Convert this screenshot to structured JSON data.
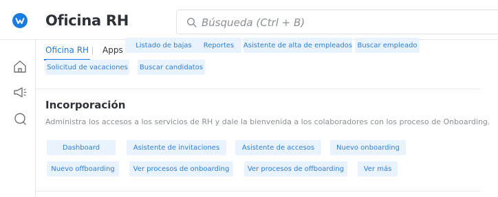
{
  "header": {
    "app_title": "Oficina RH",
    "search_placeholder": "Búsqueda (Ctrl + B)"
  },
  "tabs": [
    {
      "label": "Oficina RH",
      "active": true
    },
    {
      "label": "Apps",
      "active": false
    }
  ],
  "top_links_row1": [
    "Listado de bajas",
    "Reportes",
    "Asistente de alta de empleados",
    "Buscar empleado"
  ],
  "top_links_row2": [
    "Solicitud de vacaciones",
    "Buscar candidatos"
  ],
  "section": {
    "title": "Incorporación",
    "description": "Administra los accesos a los servicios de RH y dale la bienvenida a los colaboradores con los proceso de Onboarding.",
    "actions_row1": [
      "Dashboard",
      "Asistente de invitaciones",
      "Asistente de accesos",
      "Nuevo onboarding"
    ],
    "actions_row2": [
      "Nuevo offboarding",
      "Ver procesos de onboarding",
      "Ver procesos de offboarding",
      "Ver más"
    ]
  },
  "rail_icons": [
    "home-icon",
    "megaphone-icon",
    "chat-icon"
  ],
  "colors": {
    "brand": "#1a7be0",
    "chip_bg": "#e9f3fd",
    "chip_text": "#2d7dd2"
  }
}
